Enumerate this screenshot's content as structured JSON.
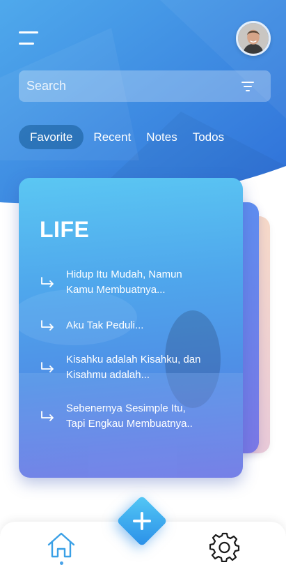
{
  "header": {
    "menu_icon": "menu-icon",
    "avatar_icon": "user-avatar"
  },
  "search": {
    "placeholder": "Search",
    "value": "",
    "filter_icon": "filter-icon"
  },
  "tabs": [
    {
      "label": "Favorite",
      "active": true
    },
    {
      "label": "Recent",
      "active": false
    },
    {
      "label": "Notes",
      "active": false
    },
    {
      "label": "Todos",
      "active": false
    }
  ],
  "card": {
    "title": "LIFE",
    "items": [
      {
        "line1": "Hidup Itu Mudah, Namun",
        "line2": "Kamu Membuatnya..."
      },
      {
        "line1": "Aku Tak Peduli...",
        "line2": ""
      },
      {
        "line1": "Kisahku adalah Kisahku, dan",
        "line2": "Kisahmu adalah..."
      },
      {
        "line1": "Sebenernya Sesimple Itu,",
        "line2": "Tapi Engkau Membuatnya.."
      }
    ],
    "item_icon": "subdirectory-arrow-icon"
  },
  "bottom_nav": {
    "home_icon": "home-icon",
    "add_icon": "plus-icon",
    "settings_icon": "gear-icon"
  },
  "colors": {
    "header_gradient_start": "#4fa9ec",
    "header_gradient_end": "#2e6fd8",
    "card_gradient_top": "#5bc7f3",
    "card_gradient_bottom": "#6a75e5",
    "fab_start": "#54c8f5",
    "fab_end": "#2a8fe8",
    "active_tab": "#1f6fa8",
    "nav_icon": "#3aa0e6"
  }
}
